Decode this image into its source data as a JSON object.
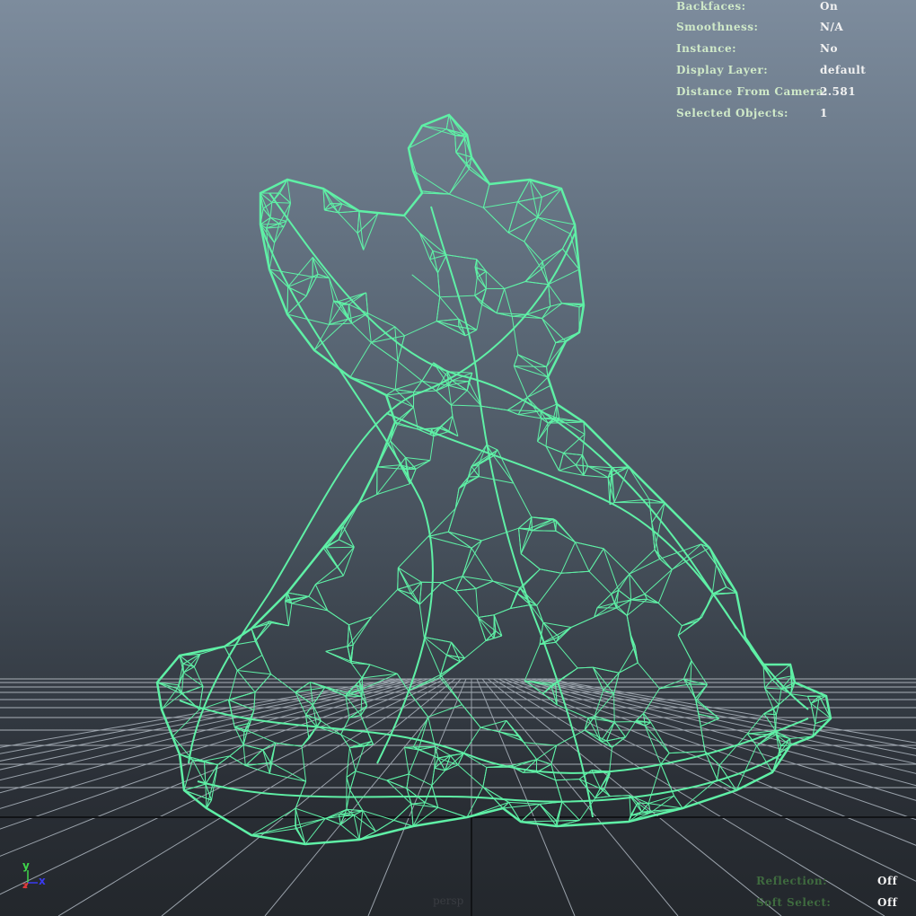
{
  "viewport": {
    "camera": "persp",
    "background_top": "#7d8c9d",
    "background_bottom": "#23272c",
    "wireframe_color": "#5ff0a6"
  },
  "hud_top": {
    "rows": [
      {
        "label": "Backfaces:",
        "value": "On"
      },
      {
        "label": "Smoothness:",
        "value": "N/A"
      },
      {
        "label": "Instance:",
        "value": "No"
      },
      {
        "label": "Display Layer:",
        "value": "default"
      },
      {
        "label": "Distance From Camera:",
        "value": "2.581"
      },
      {
        "label": "Selected Objects:",
        "value": "1"
      }
    ]
  },
  "hud_bottom": {
    "rows": [
      {
        "label": "Reflection:",
        "value": "Off"
      },
      {
        "label": "Soft Select:",
        "value": "Off"
      }
    ]
  },
  "axis_gizmo": {
    "y": "y",
    "x": "x",
    "z": "z",
    "colors": {
      "x": "#3a3af0",
      "y": "#3fd64a",
      "z": "#e03a3a"
    }
  }
}
